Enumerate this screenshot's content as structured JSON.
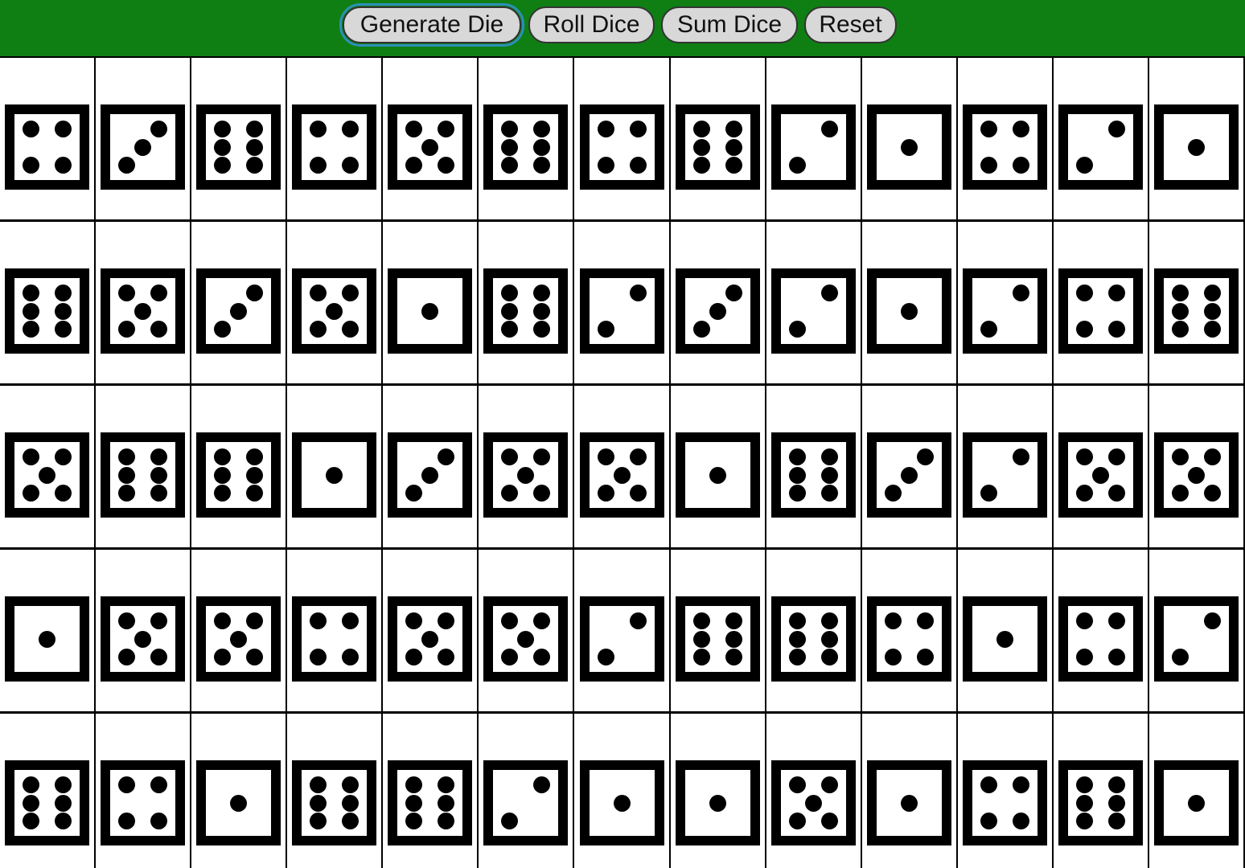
{
  "toolbar": {
    "buttons": [
      {
        "id": "generate-die-button",
        "label": "Generate Die",
        "focused": true
      },
      {
        "id": "roll-dice-button",
        "label": "Roll Dice",
        "focused": false
      },
      {
        "id": "sum-dice-button",
        "label": "Sum Dice",
        "focused": false
      },
      {
        "id": "reset-button",
        "label": "Reset",
        "focused": false
      }
    ]
  },
  "colors": {
    "toolbar_bg": "#0f7f14",
    "button_bg": "#d8d8d8",
    "focus_ring": "#2c8fb8",
    "die": "#000000"
  },
  "dice": [
    [
      4,
      3,
      6,
      4,
      5,
      6,
      4,
      6,
      2,
      1,
      4,
      2,
      1
    ],
    [
      6,
      5,
      3,
      5,
      1,
      6,
      2,
      3,
      2,
      1,
      2,
      4,
      6
    ],
    [
      5,
      6,
      6,
      1,
      3,
      5,
      5,
      1,
      6,
      3,
      2,
      5,
      5
    ],
    [
      1,
      5,
      5,
      4,
      5,
      5,
      2,
      6,
      6,
      4,
      1,
      4,
      2
    ],
    [
      6,
      4,
      1,
      6,
      6,
      2,
      1,
      1,
      5,
      1,
      4,
      6,
      1
    ]
  ]
}
